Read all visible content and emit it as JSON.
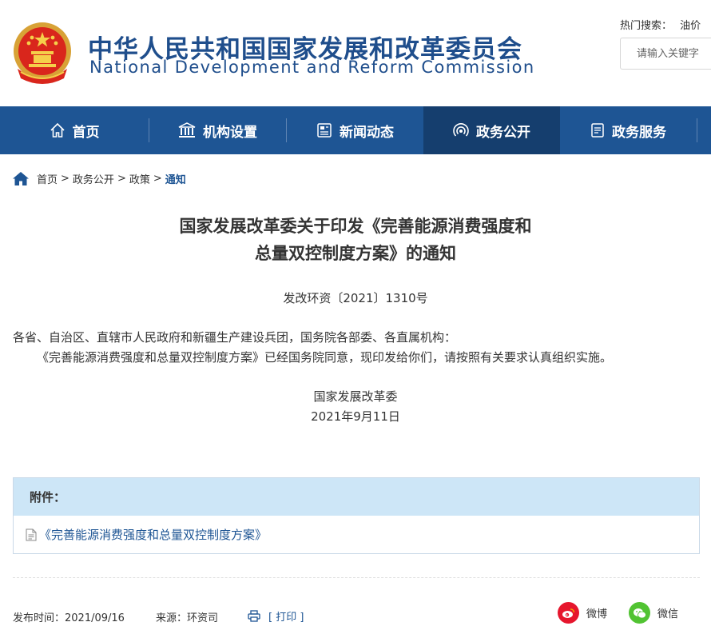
{
  "header": {
    "site_title": "中华人民共和国国家发展和改革委员会",
    "site_subtitle": "National Development and Reform Commission",
    "hot_search_label": "热门搜索：",
    "hot_search_keywords": [
      "油价",
      "价"
    ],
    "search_placeholder": "请输入关键字"
  },
  "nav": {
    "items": [
      {
        "label": "首页",
        "icon": "home-outline-icon"
      },
      {
        "label": "机构设置",
        "icon": "institution-icon"
      },
      {
        "label": "新闻动态",
        "icon": "newspaper-icon"
      },
      {
        "label": "政务公开",
        "icon": "broadcast-icon",
        "active": true
      },
      {
        "label": "政务服务",
        "icon": "document-icon"
      }
    ]
  },
  "breadcrumb": {
    "items": [
      "首页",
      "政务公开",
      "政策"
    ],
    "current": "通知",
    "separator": ">"
  },
  "article": {
    "title_line1": "国家发展改革委关于印发《完善能源消费强度和",
    "title_line2": "总量双控制度方案》的通知",
    "doc_number": "发改环资〔2021〕1310号",
    "salutation": "各省、自治区、直辖市人民政府和新疆生产建设兵团，国务院各部委、各直属机构：",
    "body": "《完善能源消费强度和总量双控制度方案》已经国务院同意，现印发给你们，请按照有关要求认真组织实施。",
    "signature_org": "国家发展改革委",
    "signature_date": "2021年9月11日"
  },
  "attachment": {
    "header": "附件：",
    "file_name": "《完善能源消费强度和总量双控制度方案》"
  },
  "footer": {
    "publish_time": "发布时间：2021/09/16",
    "source": "来源：环资司",
    "print_label": "[ 打印 ]",
    "share_weibo": "微博",
    "share_wechat": "微信"
  },
  "colors": {
    "brand_blue": "#1e5594",
    "nav_active": "#153e6e",
    "attachment_header_bg": "#cde6f7",
    "weibo_red": "#e6162d",
    "wechat_green": "#51c332"
  }
}
